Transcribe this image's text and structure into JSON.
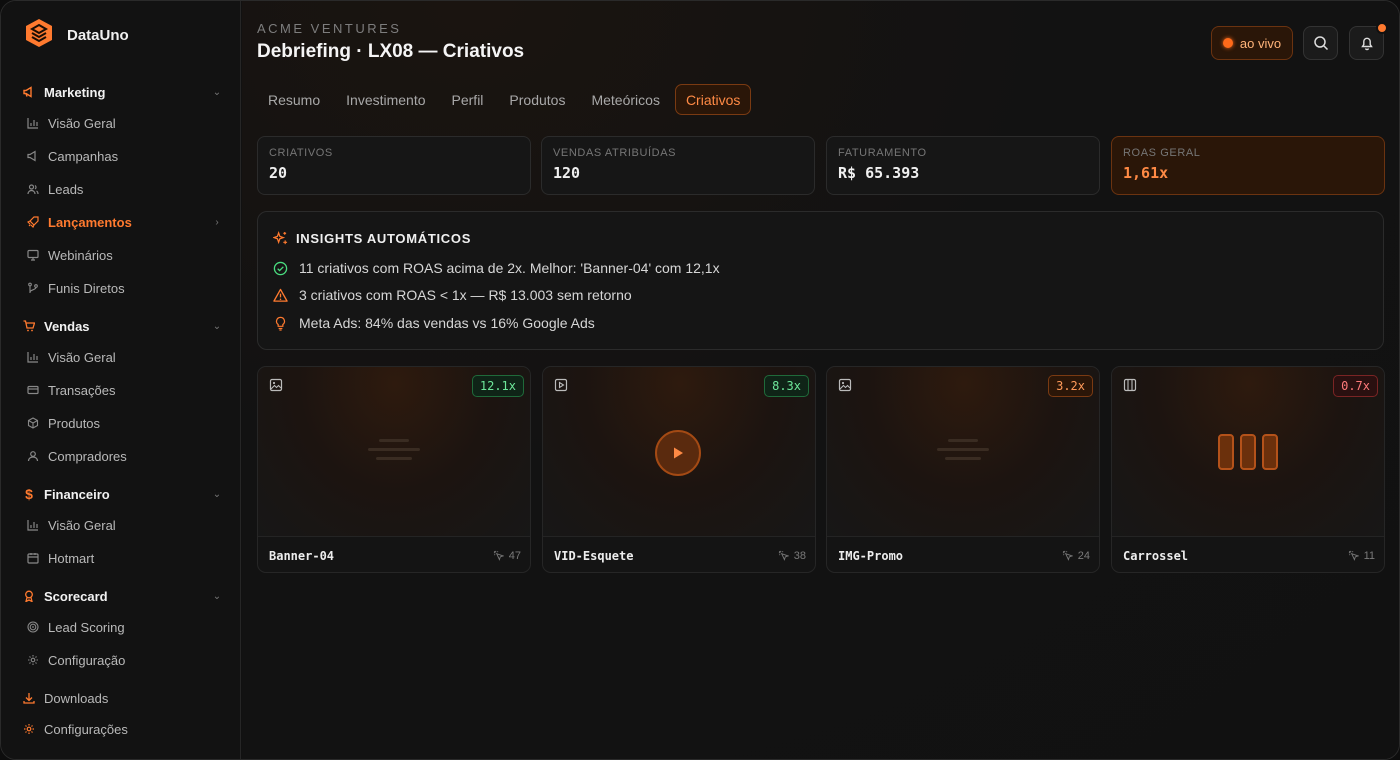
{
  "brand": {
    "name": "DataUno"
  },
  "sidebar": {
    "groups": [
      {
        "label": "Marketing",
        "items": [
          {
            "label": "Visão Geral"
          },
          {
            "label": "Campanhas"
          },
          {
            "label": "Leads"
          },
          {
            "label": "Lançamentos"
          },
          {
            "label": "Webinários"
          },
          {
            "label": "Funis Diretos"
          }
        ]
      },
      {
        "label": "Vendas",
        "items": [
          {
            "label": "Visão Geral"
          },
          {
            "label": "Transações"
          },
          {
            "label": "Produtos"
          },
          {
            "label": "Compradores"
          }
        ]
      },
      {
        "label": "Financeiro",
        "items": [
          {
            "label": "Visão Geral"
          },
          {
            "label": "Hotmart"
          }
        ]
      },
      {
        "label": "Scorecard",
        "items": [
          {
            "label": "Lead Scoring"
          },
          {
            "label": "Configuração"
          }
        ]
      }
    ],
    "bottom": [
      {
        "label": "Downloads"
      },
      {
        "label": "Configurações"
      }
    ],
    "active_item": "Lançamentos"
  },
  "header": {
    "eyebrow": "ACME VENTURES",
    "title": "Debriefing · LX08 — Criativos",
    "live_label": "ao vivo",
    "accent_color": "#ff7a2f"
  },
  "tabs": [
    {
      "label": "Resumo"
    },
    {
      "label": "Investimento"
    },
    {
      "label": "Perfil"
    },
    {
      "label": "Produtos"
    },
    {
      "label": "Meteóricos"
    },
    {
      "label": "Criativos"
    }
  ],
  "active_tab": "Criativos",
  "kpis": [
    {
      "label": "CRIATIVOS",
      "value": "20"
    },
    {
      "label": "VENDAS ATRIBUÍDAS",
      "value": "120"
    },
    {
      "label": "FATURAMENTO",
      "value": "R$ 65.393"
    },
    {
      "label": "ROAS GERAL",
      "value": "1,61x"
    }
  ],
  "insights": {
    "title": "INSIGHTS AUTOMÁTICOS",
    "items": [
      {
        "icon": "check-circle-icon",
        "text": "11 criativos com ROAS acima de 2x. Melhor: 'Banner-04' com 12,1x"
      },
      {
        "icon": "warning-icon",
        "text": "3 criativos com ROAS < 1x — R$ 13.003 sem retorno"
      },
      {
        "icon": "lightbulb-icon",
        "text": "Meta Ads: 84% das vendas vs 16% Google Ads"
      }
    ]
  },
  "creatives": [
    {
      "name": "Banner-04",
      "roas": "12.1x",
      "count": "47",
      "type": "image-icon",
      "status": "green"
    },
    {
      "name": "VID-Esquete",
      "roas": "8.3x",
      "count": "38",
      "type": "video-icon",
      "status": "green"
    },
    {
      "name": "IMG-Promo",
      "roas": "3.2x",
      "count": "24",
      "type": "image-icon",
      "status": "orange"
    },
    {
      "name": "Carrossel",
      "roas": "0.7x",
      "count": "11",
      "type": "carousel-icon",
      "status": "red"
    }
  ]
}
